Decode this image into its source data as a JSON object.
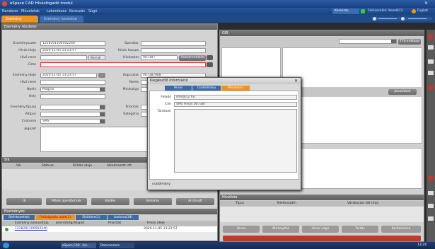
{
  "app": {
    "title": "eSpace CAD Hívásfogadó modul"
  },
  "menu": [
    "Rendszer",
    "Műveletek",
    "Lekérdezés",
    "Kereszás",
    "Súgó"
  ],
  "header": {
    "status_label": "Kereszás",
    "user_label": "Felhasználó: Kezelő?3",
    "extra_label": "Foglalt"
  },
  "tabs": [
    {
      "label": "Esemény"
    },
    {
      "label": "Esemény keresése"
    }
  ],
  "left": {
    "section_title": "Esemény részletei",
    "fields": {
      "esemenyszam_label": "Eseményszám",
      "esemenyszam_value": "1228201100502240",
      "operator_label": "Operátor",
      "operator_value": "",
      "hivas_ideje_label": "Hívás ideje",
      "hivas_ideje_value": "2020-11-05 13:23:57",
      "hivas_hossza_label": "Hívás hossza",
      "hivo_neve_label": "Hívó neve",
      "normal_label": "Normál",
      "hivoszam_label": "Hívószám",
      "hivoszam_value": "007387",
      "hozzarendeles_label": "Hozzárendelés",
      "cime_label": "Címe",
      "esemeny_ideje_label": "Esemény ideje",
      "esemeny_ideje_value": "2020-11-05 13:23:57",
      "kapcsolat_label": "Kapcsolat",
      "kapcsolat_value": "067387988",
      "hivo_neve2_label": "Hívó neve",
      "neme_label": "Neme",
      "nyelv_label": "Nyelv",
      "nyelv_value": "Magyar",
      "mindsziga_label": "Mindsziga",
      "hely_label": "Hely",
      "esemeny_tipusa_label": "Esemény típusa",
      "prioritas_label": "Prioritás",
      "altipus_label": "Altípus",
      "kategoria_label": "Kategória",
      "csatorna_label": "Csatorna",
      "csatorna_value": "SMS",
      "jegyzet_label": "Jegyzet"
    },
    "buttons": {
      "uj": "Új",
      "masik": "Másik operátornak",
      "kuldes": "Küldés",
      "bezaras": "Bezárás",
      "archivalt": "Archivált"
    },
    "sik": {
      "title": "Sík",
      "cols": [
        "Sík",
        "Státusz",
        "Küldés ideje",
        "Alkalmazott idő"
      ]
    },
    "events": {
      "title": "Események",
      "tabs": [
        "Beérkezettek",
        "Feldolgozás alatt(1)",
        "Elküldve(1)",
        "Lezárva(34)"
      ],
      "cols": [
        "Esemény azonosítója",
        "Jelentőség/állapot",
        "Prioritás",
        "Hívás ideje"
      ],
      "row": {
        "id": "1228201100502240",
        "time": "2020-11-05 13:23:57"
      }
    }
  },
  "right": {
    "gis_title": "GIS",
    "gis_button": "TTS indítása",
    "vezerlo_button": "Javaslatok",
    "contacts_title": "Hívólista",
    "contacts_cols": [
      "Típus",
      "Telefonszám",
      "Várakozási idő (mp)"
    ],
    "action_buttons": [
      "Hívás",
      "Átirányítás",
      "Hívás vége",
      "Tartás",
      "Konferencia"
    ]
  },
  "dialog": {
    "title": "Kiegészítő információ",
    "tabs": [
      "Hívás",
      "Csatolmány",
      "Részletes"
    ],
    "fields": {
      "felado_label": "Feladó",
      "felado_value": "sms@12.hu",
      "cim_label": "Cím",
      "cim_value": "SMS Hívás 007387",
      "tartalom_label": "Tartalom",
      "tartalom_value": ""
    },
    "footer_label": "csatolmány"
  },
  "taskbar": {
    "items": [
      "eSpace CAD - Hív...",
      "Dokumentum"
    ],
    "clock": "13:24"
  }
}
